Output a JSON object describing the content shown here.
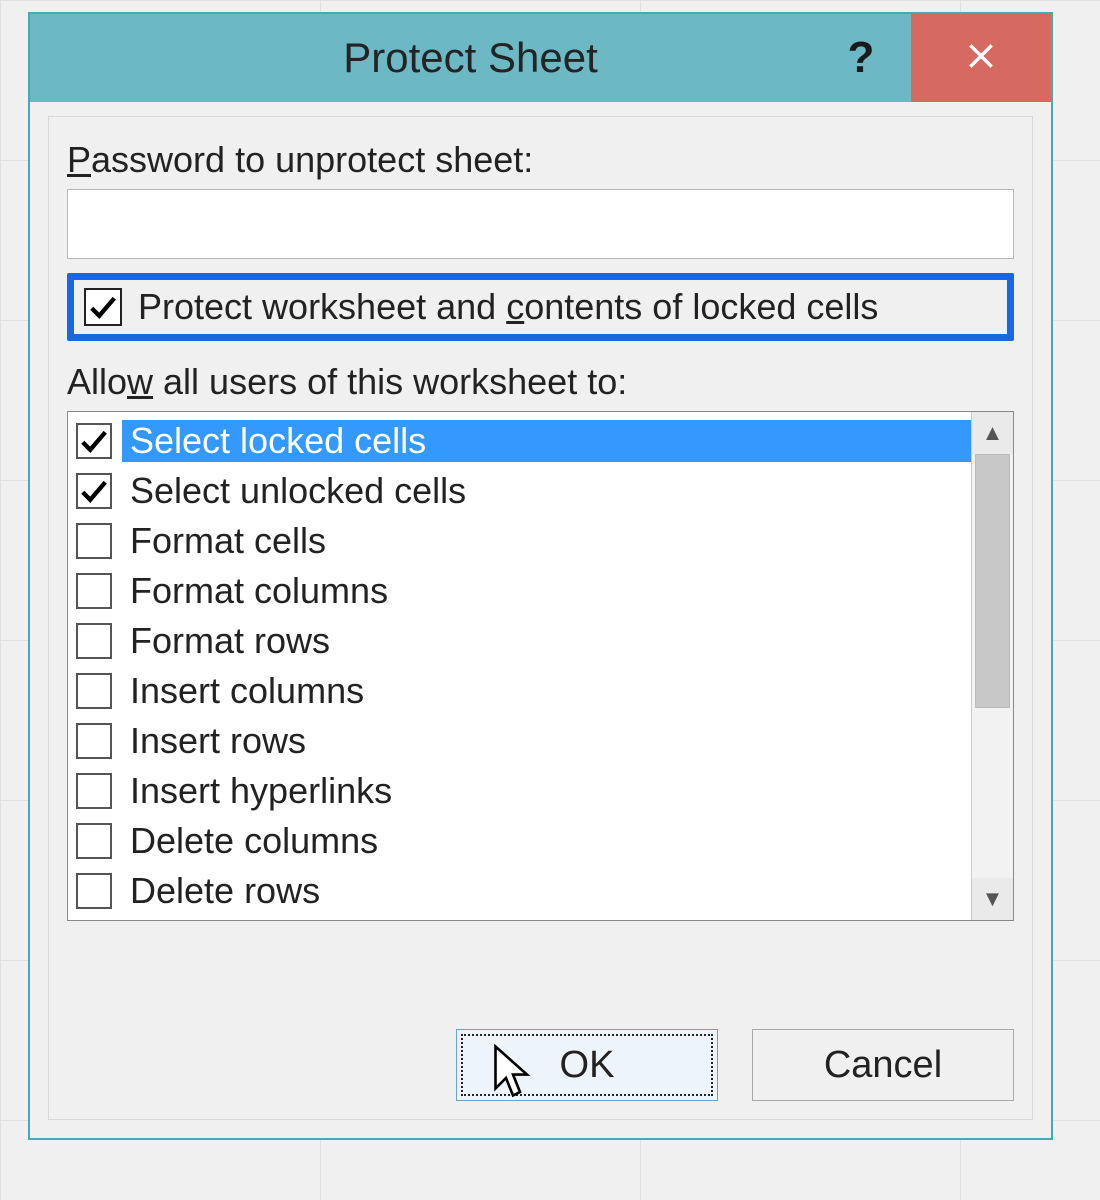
{
  "dialog": {
    "title": "Protect Sheet",
    "help_tooltip": "?",
    "password_label_pre": "P",
    "password_label_rest": "assword to unprotect sheet:",
    "password_value": "",
    "protect_checkbox": {
      "checked": true,
      "text_pre": "Protect worksheet and ",
      "text_underline": "c",
      "text_post": "ontents of locked cells"
    },
    "allow_label_pre": "Allo",
    "allow_label_underline": "w",
    "allow_label_post": " all users of this worksheet to:",
    "permissions": [
      {
        "label": "Select locked cells",
        "checked": true,
        "selected": true
      },
      {
        "label": "Select unlocked cells",
        "checked": true,
        "selected": false
      },
      {
        "label": "Format cells",
        "checked": false,
        "selected": false
      },
      {
        "label": "Format columns",
        "checked": false,
        "selected": false
      },
      {
        "label": "Format rows",
        "checked": false,
        "selected": false
      },
      {
        "label": "Insert columns",
        "checked": false,
        "selected": false
      },
      {
        "label": "Insert rows",
        "checked": false,
        "selected": false
      },
      {
        "label": "Insert hyperlinks",
        "checked": false,
        "selected": false
      },
      {
        "label": "Delete columns",
        "checked": false,
        "selected": false
      },
      {
        "label": "Delete rows",
        "checked": false,
        "selected": false
      }
    ],
    "buttons": {
      "ok": "OK",
      "cancel": "Cancel"
    }
  }
}
